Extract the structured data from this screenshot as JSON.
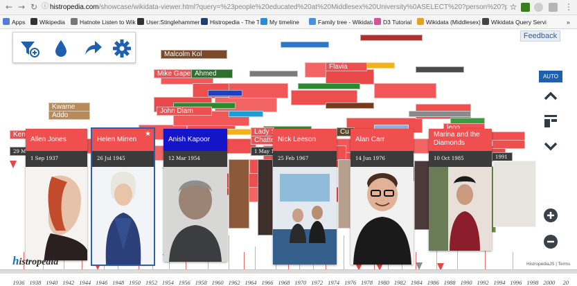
{
  "browser": {
    "url_host": "histropedia.com",
    "url_path": "/showcase/wikidata-viewer.html?query=%23people%20educated%20at%20Middlesex%20University%0ASELECT%20?person%20?personLabel%20",
    "bookmarks": [
      {
        "label": "Apps",
        "icon": "apps-icon",
        "color": "#4f7fd8"
      },
      {
        "label": "Wikipedia",
        "icon": "wikipedia-icon",
        "color": "#333333"
      },
      {
        "label": "Hatnote Listen to Wiki",
        "icon": "page-icon",
        "color": "#777777"
      },
      {
        "label": "User:Stinglehammer",
        "icon": "wikipedia-icon",
        "color": "#333333"
      },
      {
        "label": "Histropedia - The Tim",
        "icon": "histropedia-icon",
        "color": "#1f3f6f"
      },
      {
        "label": "My timeline",
        "icon": "timeline-icon",
        "color": "#2a8cd6"
      },
      {
        "label": "Family tree - Wikidata",
        "icon": "family-tree-icon",
        "color": "#4a90e2"
      },
      {
        "label": "D3 Tutorial",
        "icon": "d3-icon",
        "color": "#d84f9c"
      },
      {
        "label": "Wikidata (Middlesex)",
        "icon": "wikidata-icon",
        "color": "#e6a21c"
      },
      {
        "label": "Wikidata Query Servi",
        "icon": "query-icon",
        "color": "#444444"
      }
    ],
    "more_bookmarks": "»"
  },
  "toolbar": {
    "icons": [
      "filter-add-icon",
      "color-drop-icon",
      "share-arrow-icon",
      "settings-gear-icon"
    ],
    "accent": "#1f5fb0"
  },
  "feedback_label": "Feedback",
  "auto_label": "AUTO",
  "background_labels": [
    "Malcolm Kol",
    "Mike Gape",
    "Ahmed",
    "Kwame",
    "Addo",
    "John Diam",
    "Flavia",
    "Lady S",
    "Chatte",
    "Cu",
    "leon",
    "alo",
    "hammad",
    "Ken",
    "29 Ma",
    "1 May 1",
    "1991"
  ],
  "cards": [
    {
      "name": "Allen Jones",
      "date": "1 Sep 1937",
      "head_color": "#f04f4f"
    },
    {
      "name": "Helen Mirren",
      "date": "26 Jul 1945",
      "head_color": "#f04f4f",
      "starred": true
    },
    {
      "name": "Anish Kapoor",
      "date": "12 Mar 1954",
      "head_color": "#1414c8"
    },
    {
      "name": "Nick Leeson",
      "date": "25 Feb 1967",
      "head_color": "#f04f4f"
    },
    {
      "name": "Alan Carr",
      "date": "14 Jun 1976",
      "head_color": "#f04f4f"
    },
    {
      "name": "Marina and the Diamonds",
      "date": "10 Oct 1985",
      "head_color": "#f04f4f"
    }
  ],
  "star_glyph": "★",
  "timeline": {
    "years": [
      "1936",
      "1938",
      "1940",
      "1942",
      "1944",
      "1946",
      "1948",
      "1950",
      "1952",
      "1954",
      "1956",
      "1958",
      "1960",
      "1962",
      "1964",
      "1966",
      "1968",
      "1970",
      "1972",
      "1974",
      "1976",
      "1978",
      "1980",
      "1982",
      "1984",
      "1986",
      "1988",
      "1990",
      "1992",
      "1994",
      "1996",
      "1998",
      "2000",
      "20"
    ]
  },
  "logo": {
    "first": "h",
    "rest": "istropedia"
  },
  "credits": "HistropediaJS | Terms"
}
